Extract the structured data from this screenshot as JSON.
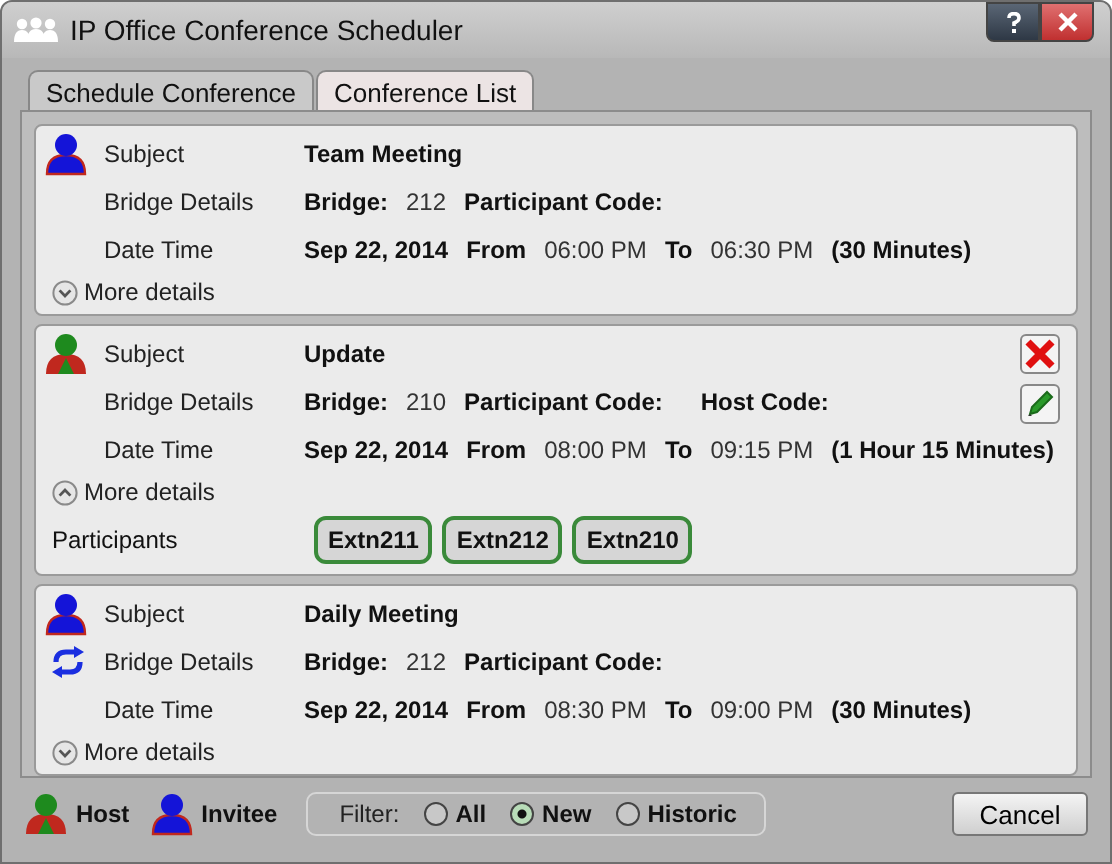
{
  "window": {
    "title": "IP Office Conference Scheduler"
  },
  "tabs": [
    {
      "label": "Schedule Conference",
      "selected": false
    },
    {
      "label": "Conference List",
      "selected": true
    }
  ],
  "conferences": [
    {
      "kind": "invitee",
      "recurring": false,
      "editable": false,
      "expanded": false,
      "subject_label": "Subject",
      "subject": "Team Meeting",
      "bridge_label": "Bridge Details",
      "bridge_key": "Bridge:",
      "bridge": "212",
      "participant_code_key": "Participant Code:",
      "date_label": "Date Time",
      "date": "Sep 22, 2014",
      "from_key": "From",
      "from": "06:00 PM",
      "to_key": "To",
      "to": "06:30 PM",
      "duration": "(30 Minutes)",
      "more_details": "More details"
    },
    {
      "kind": "host",
      "recurring": false,
      "editable": true,
      "expanded": true,
      "subject_label": "Subject",
      "subject": "Update",
      "bridge_label": "Bridge Details",
      "bridge_key": "Bridge:",
      "bridge": "210",
      "participant_code_key": "Participant Code:",
      "host_code_key": "Host Code:",
      "date_label": "Date Time",
      "date": "Sep 22, 2014",
      "from_key": "From",
      "from": "08:00 PM",
      "to_key": "To",
      "to": "09:15 PM",
      "duration": "(1 Hour 15 Minutes)",
      "more_details": "More details",
      "participants_label": "Participants",
      "participants": [
        "Extn211",
        "Extn212",
        "Extn210"
      ]
    },
    {
      "kind": "invitee",
      "recurring": true,
      "editable": false,
      "expanded": false,
      "subject_label": "Subject",
      "subject": "Daily Meeting",
      "bridge_label": "Bridge Details",
      "bridge_key": "Bridge:",
      "bridge": "212",
      "participant_code_key": "Participant Code:",
      "date_label": "Date Time",
      "date": "Sep 22, 2014",
      "from_key": "From",
      "from": "08:30 PM",
      "to_key": "To",
      "to": "09:00 PM",
      "duration": "(30 Minutes)",
      "more_details": "More details"
    }
  ],
  "legend": [
    {
      "kind": "host",
      "label": "Host"
    },
    {
      "kind": "invitee",
      "label": "Invitee"
    }
  ],
  "filter": {
    "label": "Filter:",
    "options": [
      {
        "label": "All",
        "selected": false
      },
      {
        "label": "New",
        "selected": true
      },
      {
        "label": "Historic",
        "selected": false
      }
    ]
  },
  "buttons": [
    "Cancel"
  ]
}
